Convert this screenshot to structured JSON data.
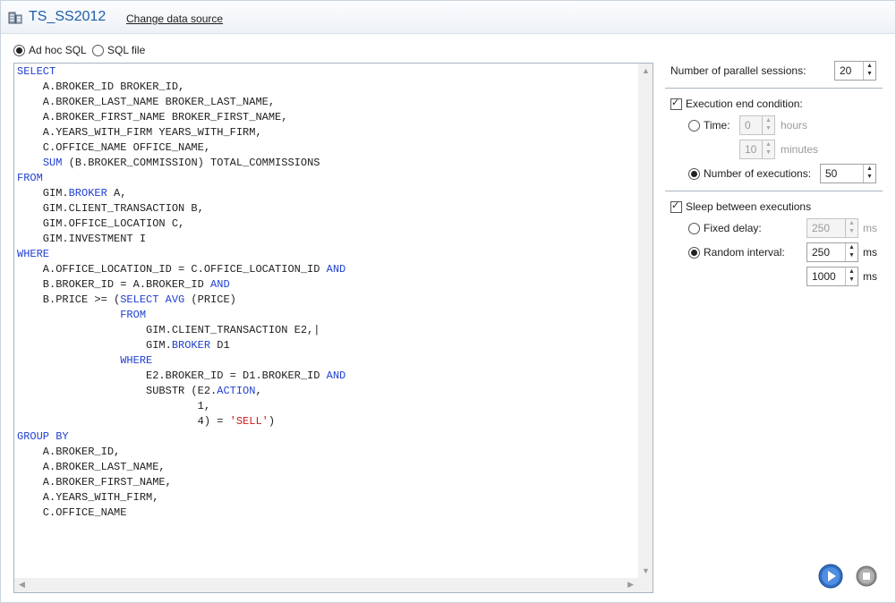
{
  "header": {
    "title": "TS_SS2012",
    "change_source_link": "Change data source"
  },
  "source_options": {
    "adhoc_label": "Ad hoc SQL",
    "sqlfile_label": "SQL file",
    "selected": "Ad hoc SQL"
  },
  "editor": {
    "lines": [
      [
        {
          "t": "SELECT",
          "k": 1
        }
      ],
      [
        {
          "t": "    A.BROKER_ID BROKER_ID,"
        }
      ],
      [
        {
          "t": "    A.BROKER_LAST_NAME BROKER_LAST_NAME,"
        }
      ],
      [
        {
          "t": "    A.BROKER_FIRST_NAME BROKER_FIRST_NAME,"
        }
      ],
      [
        {
          "t": "    A.YEARS_WITH_FIRM YEARS_WITH_FIRM,"
        }
      ],
      [
        {
          "t": "    C.OFFICE_NAME OFFICE_NAME,"
        }
      ],
      [
        {
          "t": "    "
        },
        {
          "t": "SUM",
          "k": 1
        },
        {
          "t": " (B.BROKER_COMMISSION) TOTAL_COMMISSIONS"
        }
      ],
      [
        {
          "t": "FROM",
          "k": 1
        }
      ],
      [
        {
          "t": "    GIM."
        },
        {
          "t": "BROKER",
          "k": 1
        },
        {
          "t": " A,"
        }
      ],
      [
        {
          "t": "    GIM.CLIENT_TRANSACTION B,"
        }
      ],
      [
        {
          "t": "    GIM.OFFICE_LOCATION C,"
        }
      ],
      [
        {
          "t": "    GIM.INVESTMENT I"
        }
      ],
      [
        {
          "t": "WHERE",
          "k": 1
        }
      ],
      [
        {
          "t": "    A.OFFICE_LOCATION_ID = C.OFFICE_LOCATION_ID "
        },
        {
          "t": "AND",
          "k": 1
        }
      ],
      [
        {
          "t": "    B.BROKER_ID = A.BROKER_ID "
        },
        {
          "t": "AND",
          "k": 1
        }
      ],
      [
        {
          "t": "    B.PRICE >= ("
        },
        {
          "t": "SELECT AVG",
          "k": 1
        },
        {
          "t": " (PRICE)"
        }
      ],
      [
        {
          "t": "                "
        },
        {
          "t": "FROM",
          "k": 1
        }
      ],
      [
        {
          "t": "                    GIM.CLIENT_TRANSACTION E2,|"
        }
      ],
      [
        {
          "t": "                    GIM."
        },
        {
          "t": "BROKER",
          "k": 1
        },
        {
          "t": " D1"
        }
      ],
      [
        {
          "t": "                "
        },
        {
          "t": "WHERE",
          "k": 1
        }
      ],
      [
        {
          "t": "                    E2.BROKER_ID = D1.BROKER_ID "
        },
        {
          "t": "AND",
          "k": 1
        }
      ],
      [
        {
          "t": "                    SUBSTR (E2."
        },
        {
          "t": "ACTION",
          "k": 1
        },
        {
          "t": ","
        }
      ],
      [
        {
          "t": "                            1,"
        }
      ],
      [
        {
          "t": "                            4) = "
        },
        {
          "t": "'SELL'",
          "s": 1
        },
        {
          "t": ")"
        }
      ],
      [
        {
          "t": "GROUP BY",
          "k": 1
        }
      ],
      [
        {
          "t": "    A.BROKER_ID,"
        }
      ],
      [
        {
          "t": "    A.BROKER_LAST_NAME,"
        }
      ],
      [
        {
          "t": "    A.BROKER_FIRST_NAME,"
        }
      ],
      [
        {
          "t": "    A.YEARS_WITH_FIRM,"
        }
      ],
      [
        {
          "t": "    C.OFFICE_NAME"
        }
      ]
    ]
  },
  "settings": {
    "parallel_label": "Number of parallel sessions:",
    "parallel_value": "20",
    "end_condition_label": "Execution end condition:",
    "time_label": "Time:",
    "time_hours": "0",
    "hours_unit": "hours",
    "time_minutes": "10",
    "minutes_unit": "minutes",
    "executions_label": "Number of executions:",
    "executions_value": "50",
    "sleep_label": "Sleep between executions",
    "fixed_label": "Fixed delay:",
    "fixed_value": "250",
    "random_label": "Random interval:",
    "random_min": "250",
    "random_max": "1000",
    "ms_unit": "ms"
  },
  "colors": {
    "keyword": "#1f3fd0",
    "string": "#d11a1a",
    "title": "#1f5fa8",
    "play": "#2f6fc4",
    "stop": "#8e8e8e"
  }
}
